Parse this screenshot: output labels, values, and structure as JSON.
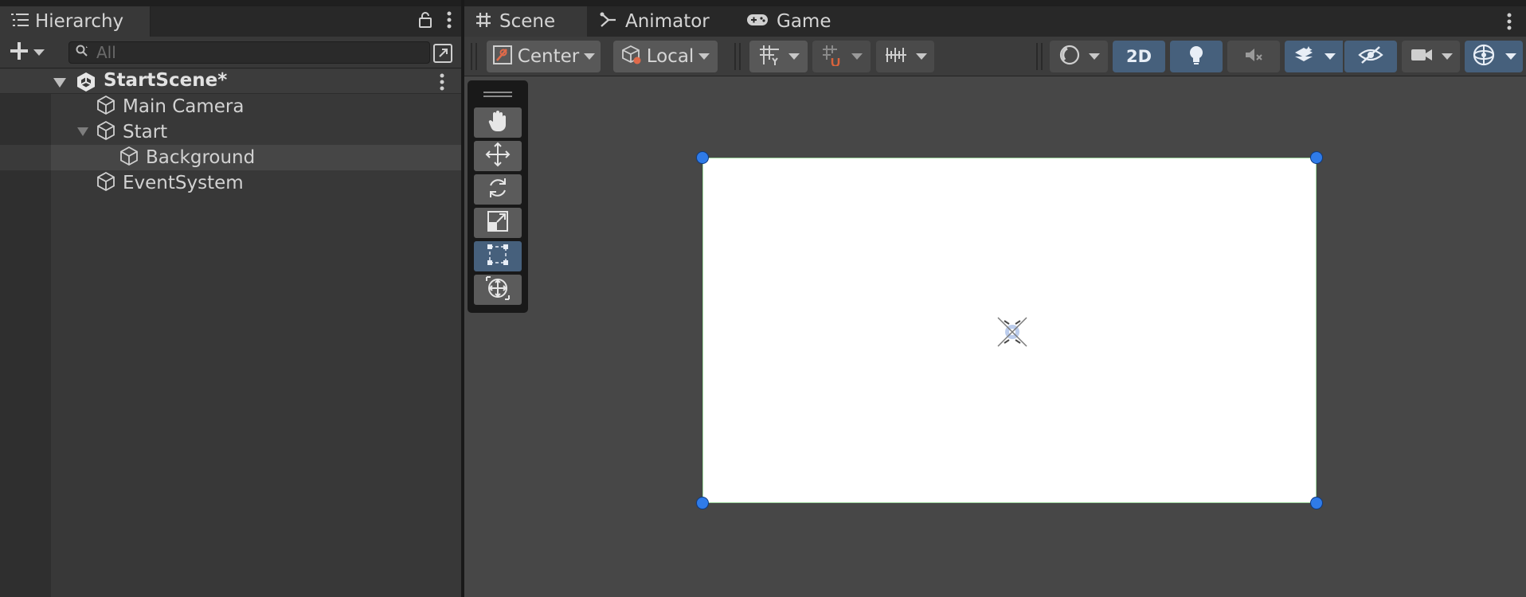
{
  "hierarchy": {
    "tab_label": "Hierarchy",
    "search_placeholder": "All",
    "scene_name": "StartScene*",
    "items": [
      {
        "label": "Main Camera"
      },
      {
        "label": "Start"
      },
      {
        "label": "Background"
      },
      {
        "label": "EventSystem"
      }
    ]
  },
  "scene_panel": {
    "tabs": [
      {
        "label": "Scene"
      },
      {
        "label": "Animator"
      },
      {
        "label": "Game"
      }
    ],
    "toolbar": {
      "pivot_mode": "Center",
      "pivot_rotation": "Local",
      "toggle_2d": "2D"
    }
  },
  "colors": {
    "accent_blue": "#46607c",
    "handle_blue": "#2f7be8",
    "panel_dark": "#383838",
    "scene_bg": "#474747"
  }
}
